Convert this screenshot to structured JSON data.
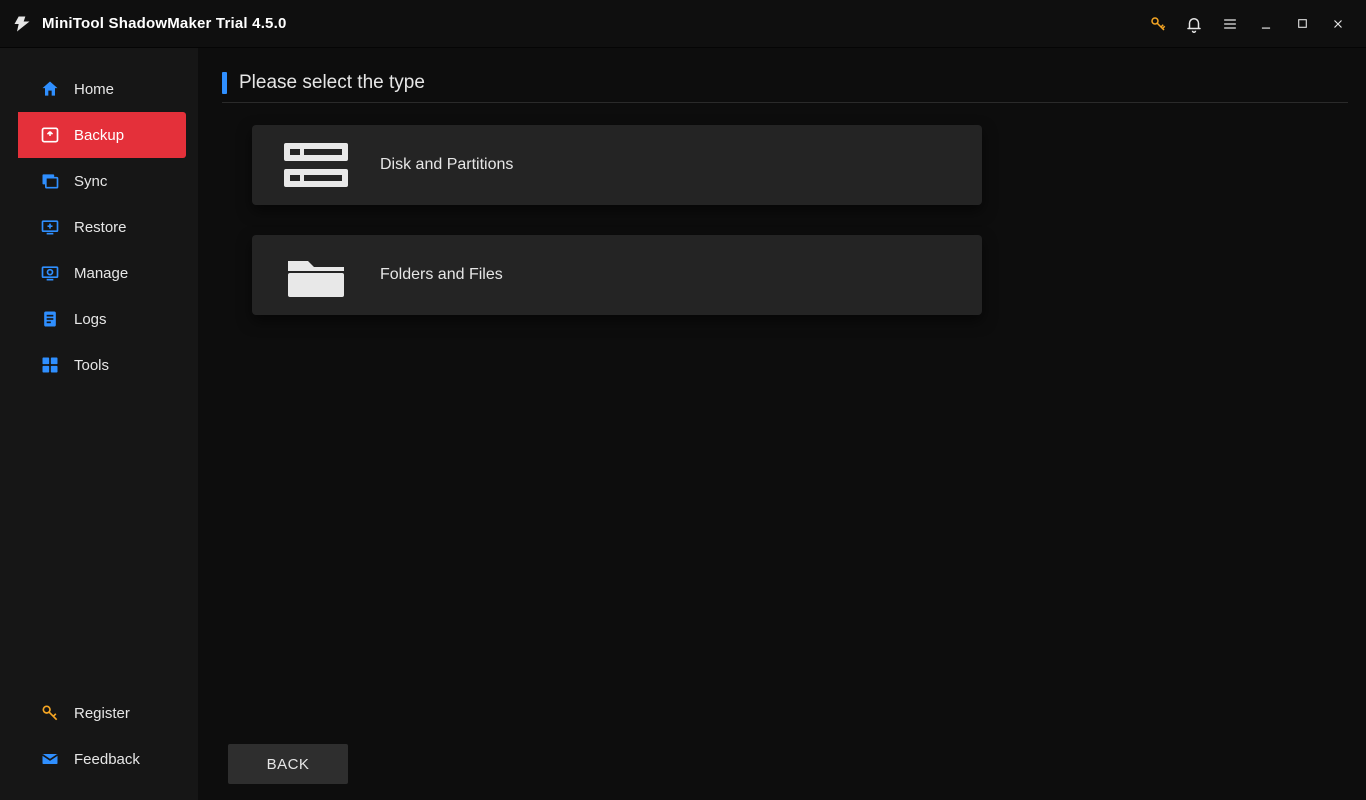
{
  "titlebar": {
    "title": "MiniTool ShadowMaker Trial 4.5.0"
  },
  "sidebar": {
    "items": [
      {
        "id": "home",
        "label": "Home"
      },
      {
        "id": "backup",
        "label": "Backup",
        "active": true
      },
      {
        "id": "sync",
        "label": "Sync"
      },
      {
        "id": "restore",
        "label": "Restore"
      },
      {
        "id": "manage",
        "label": "Manage"
      },
      {
        "id": "logs",
        "label": "Logs"
      },
      {
        "id": "tools",
        "label": "Tools"
      }
    ],
    "bottom": [
      {
        "id": "register",
        "label": "Register"
      },
      {
        "id": "feedback",
        "label": "Feedback"
      }
    ]
  },
  "main": {
    "title": "Please select the type",
    "options": [
      {
        "id": "disk",
        "label": "Disk and Partitions"
      },
      {
        "id": "folders",
        "label": "Folders and Files"
      }
    ],
    "back_label": "BACK"
  },
  "colors": {
    "accent_blue": "#2f8fff",
    "danger_red": "#e4303a",
    "key_amber": "#f6a623",
    "card_bg": "#242424"
  }
}
